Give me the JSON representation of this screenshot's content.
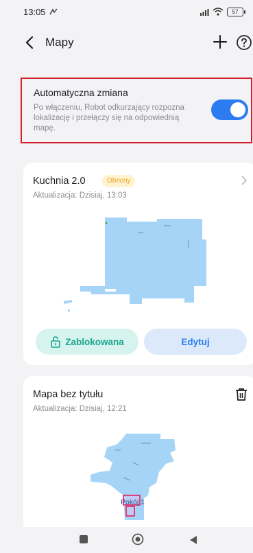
{
  "status": {
    "time": "13:05",
    "battery": "57"
  },
  "header": {
    "title": "Mapy"
  },
  "auto_switch": {
    "title": "Automatyczna zmiana",
    "description": "Po włączeniu, Robot odkurzający rozpozna lokalizację i przełączy się na odpowiednią mapę.",
    "enabled": true,
    "accent_color": "#2b7cf0"
  },
  "maps": [
    {
      "name": "Kuchnia 2.0",
      "badge": "Obecny",
      "updated": "Aktualizacja: Dzisiaj, 13:03",
      "lock_label": "Zablokowana",
      "edit_label": "Edytuj"
    },
    {
      "name": "Mapa bez tytułu",
      "updated": "Aktualizacja: Dzisiaj, 12:21",
      "room_label": "Pokój 1"
    }
  ],
  "icons": {
    "status": [
      "gesture-icon",
      "signal-icon",
      "wifi-icon",
      "battery-icon"
    ],
    "header": [
      "back-icon",
      "plus-icon",
      "help-icon"
    ],
    "cards": [
      "chevron-right-icon",
      "lock-icon",
      "trash-icon"
    ],
    "nav": [
      "recents-icon",
      "home-icon",
      "back-triangle-icon"
    ]
  }
}
